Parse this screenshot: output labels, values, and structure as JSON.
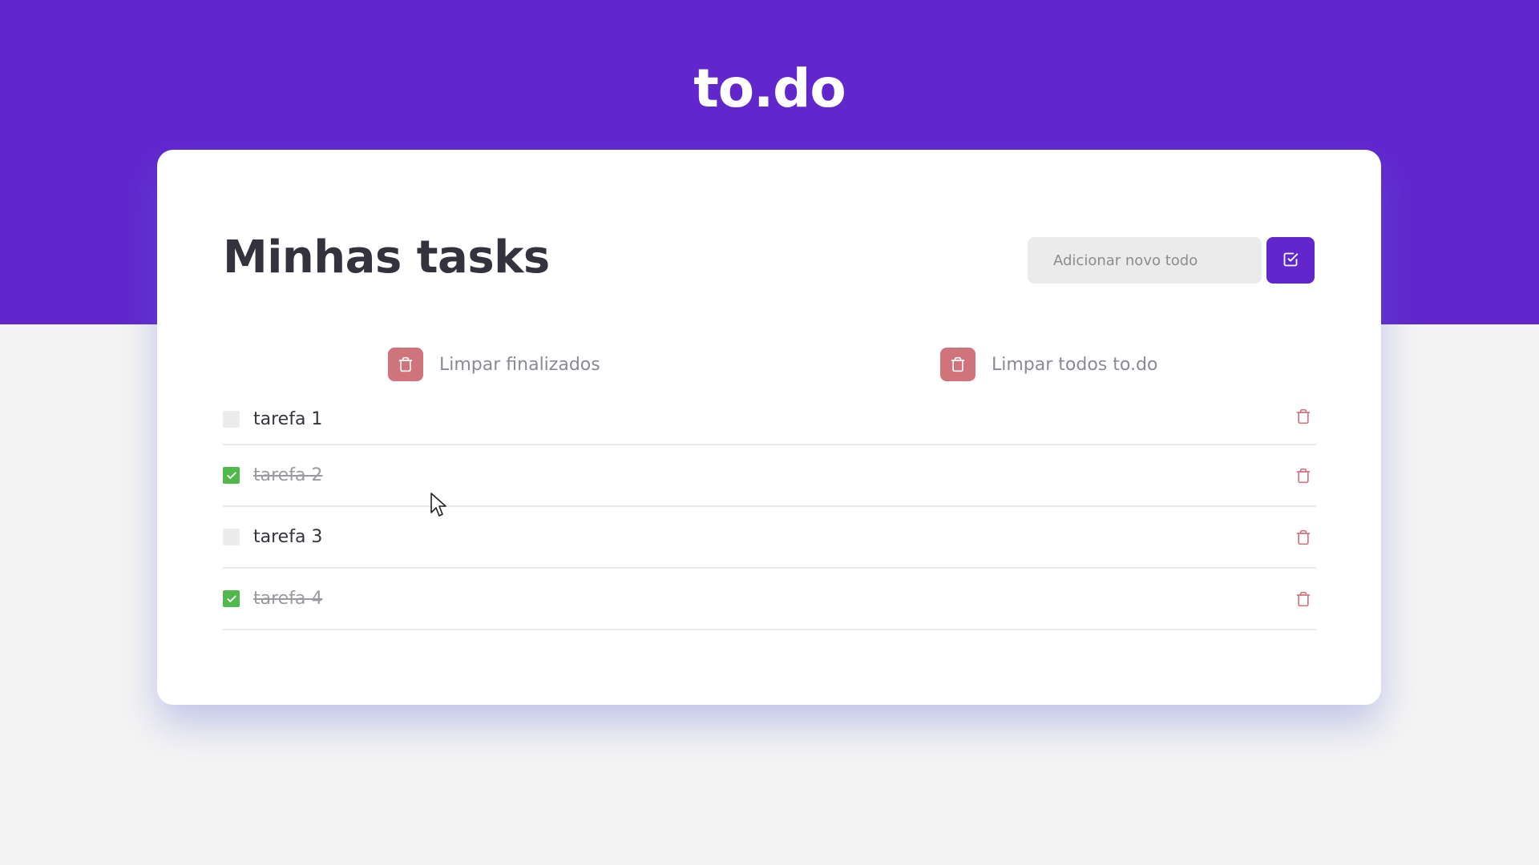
{
  "app": {
    "logo": "to.do"
  },
  "card": {
    "title": "Minhas tasks",
    "add_form": {
      "placeholder": "Adicionar novo todo",
      "value": ""
    },
    "clear_finished_label": "Limpar finalizados",
    "clear_all_label": "Limpar todos to.do"
  },
  "tasks": [
    {
      "title": "tarefa 1",
      "done": false
    },
    {
      "title": "tarefa 2",
      "done": true
    },
    {
      "title": "tarefa 3",
      "done": false
    },
    {
      "title": "tarefa 4",
      "done": true
    }
  ],
  "colors": {
    "primary": "#6127cd",
    "danger": "#d0747c",
    "done_check": "#51b84b",
    "background": "#f4f4f4"
  },
  "icons": {
    "add": "checkbox-add-icon",
    "clear": "trash-icon",
    "delete": "trash-icon",
    "check": "check-icon"
  }
}
